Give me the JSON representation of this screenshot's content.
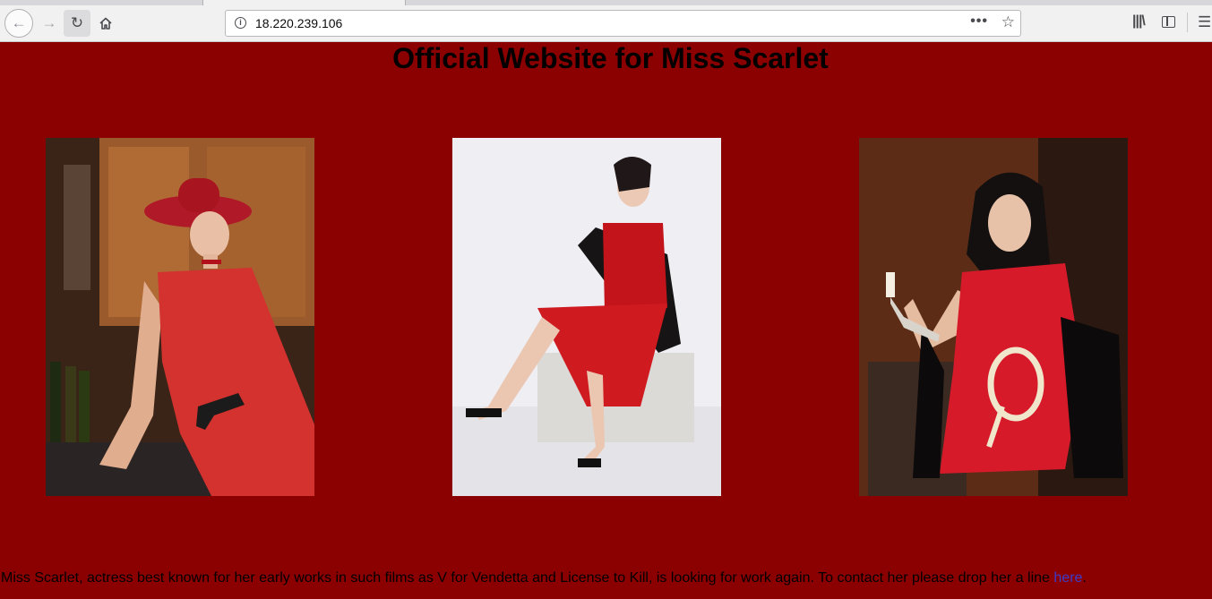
{
  "browser": {
    "url": "18.220.239.106"
  },
  "page": {
    "title": "Official Website for Miss Scarlet",
    "bio_text": "Miss Scarlet, actress best known for her early works in such films as V for Vendetta and License to Kill, is looking for work again. To contact her please drop her a line ",
    "contact_link_label": "here",
    "bio_end": "."
  },
  "colors": {
    "page_background": "#8b0000",
    "link": "#3c3cc8"
  },
  "icons": [
    "back-arrow-icon",
    "forward-arrow-icon",
    "reload-icon",
    "home-icon",
    "site-info-icon",
    "page-actions-icon",
    "bookmark-star-icon",
    "library-icon",
    "sidebar-icon",
    "hamburger-menu-icon"
  ]
}
